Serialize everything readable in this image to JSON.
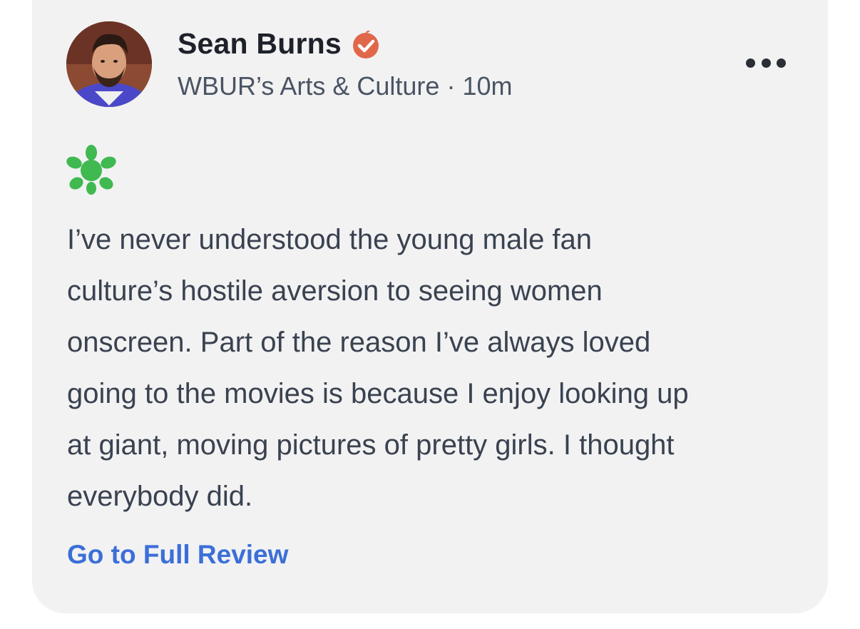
{
  "author": {
    "name": "Sean Burns",
    "verified_badge_icon": "verified-critic-icon",
    "outlet": "WBUR’s Arts & Culture",
    "separator": "·",
    "time": "10m"
  },
  "score_icon": "rotten-splat-icon",
  "review": {
    "lines": [
      "I’ve never understood the young male fan",
      "culture’s hostile aversion to seeing women",
      "onscreen. Part of the reason I’ve always loved",
      "going to the movies is because I enjoy looking up",
      "at giant, moving pictures of pretty girls. I thought",
      "everybody did."
    ]
  },
  "link": {
    "label": "Go to Full Review"
  },
  "menu": {
    "icon": "more-options-icon"
  },
  "colors": {
    "badge": "#e0674a",
    "splat": "#3fb950",
    "link": "#3b6fd8"
  }
}
